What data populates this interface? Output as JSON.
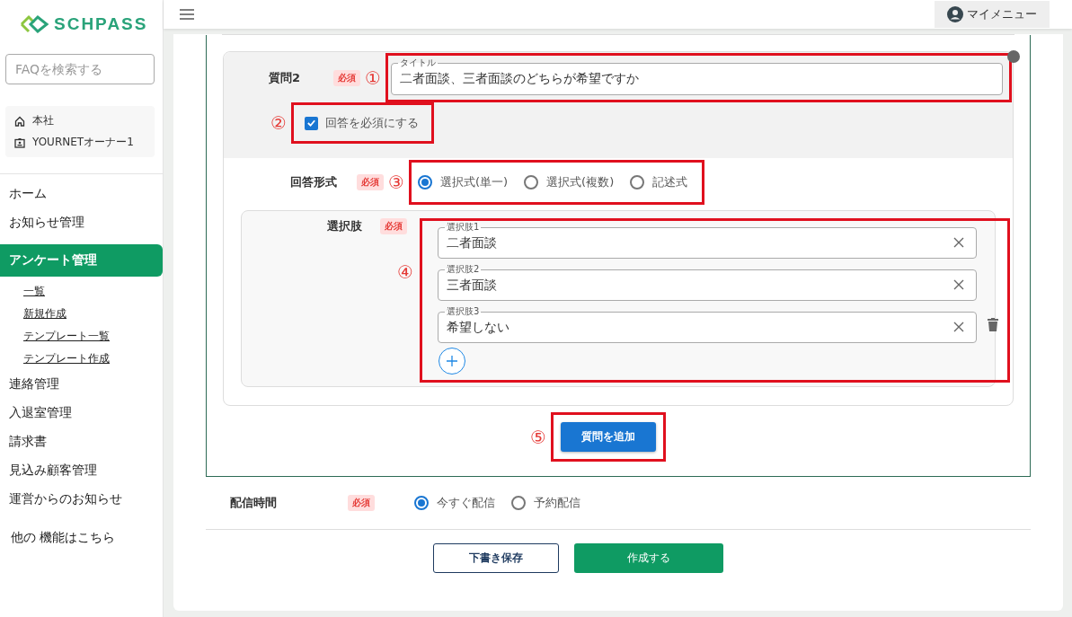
{
  "logo": {
    "text": "SCHPASS"
  },
  "search": {
    "placeholder": "FAQを検索する"
  },
  "org": {
    "office": "本社",
    "user": "YOURNETオーナー1"
  },
  "nav": [
    {
      "label": "ホーム",
      "selected": false
    },
    {
      "label": "お知らせ管理",
      "selected": false
    },
    {
      "label": "アンケート管理",
      "selected": true,
      "children": [
        {
          "label": "一覧"
        },
        {
          "label": "新規作成"
        },
        {
          "label": "テンプレート一覧"
        },
        {
          "label": "テンプレート作成"
        }
      ]
    },
    {
      "label": "連絡管理",
      "selected": false
    },
    {
      "label": "入退室管理",
      "selected": false
    },
    {
      "label": "請求書",
      "selected": false
    },
    {
      "label": "見込み顧客管理",
      "selected": false
    },
    {
      "label": "運営からのお知らせ",
      "selected": false
    }
  ],
  "other_link": "他の 機能はこちら",
  "topbar": {
    "menu_button": "マイメニュー"
  },
  "question": {
    "label": "質問2",
    "badge": "必須",
    "marker": "①",
    "title_field": {
      "label": "タイトル",
      "value": "二者面談、三者面談のどちらが希望ですか"
    },
    "required_marker": "②",
    "required_checkbox": {
      "label": "回答を必須にする",
      "checked": true
    }
  },
  "answer_format": {
    "label": "回答形式",
    "badge": "必須",
    "marker": "③",
    "options": [
      {
        "label": "選択式(単一)",
        "selected": true
      },
      {
        "label": "選択式(複数)",
        "selected": false
      },
      {
        "label": "記述式",
        "selected": false
      }
    ]
  },
  "choices": {
    "label": "選択肢",
    "badge": "必須",
    "marker": "④",
    "items": [
      {
        "label": "選択肢1",
        "value": "二者面談",
        "deletable": false
      },
      {
        "label": "選択肢2",
        "value": "三者面談",
        "deletable": false
      },
      {
        "label": "選択肢3",
        "value": "希望しない",
        "deletable": true
      }
    ]
  },
  "add_question": {
    "marker": "⑤",
    "label": "質問を追加"
  },
  "delivery": {
    "label": "配信時間",
    "badge": "必須",
    "options": [
      {
        "label": "今すぐ配信",
        "selected": true
      },
      {
        "label": "予約配信",
        "selected": false
      }
    ]
  },
  "actions": [
    {
      "label": "下書き保存",
      "kind": "outline"
    },
    {
      "label": "作成する",
      "kind": "primary"
    }
  ]
}
